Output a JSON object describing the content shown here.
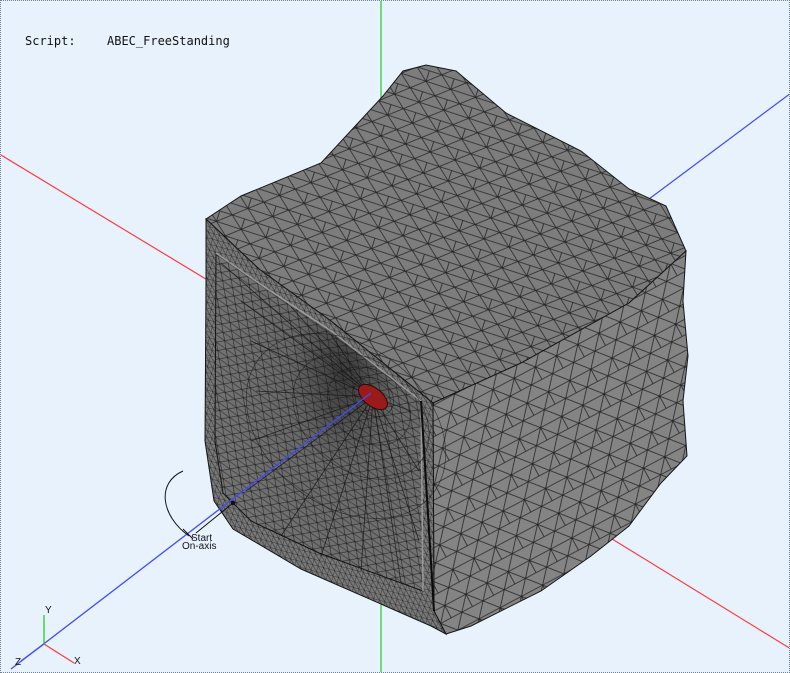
{
  "viewer": {
    "script_label": "Script:",
    "script_name": "ABEC_FreeStanding",
    "observation_labels": [
      "Start",
      "On-axis"
    ],
    "triad_labels": {
      "x": "X",
      "y": "Y",
      "z": "Z"
    }
  },
  "colors": {
    "background": "#e8f2fd",
    "mesh_fill": "#7d7d7d",
    "mesh_lines": "#141414",
    "x_axis": "#ff3b3b",
    "y_axis": "#22cc22",
    "z_axis": "#3f4bff",
    "driver": "#9b1b1b"
  },
  "icons": [
    "axis-triad-icon"
  ]
}
